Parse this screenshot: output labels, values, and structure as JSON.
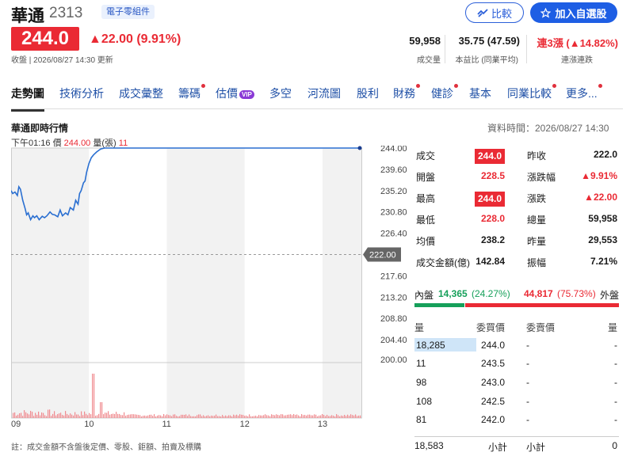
{
  "header": {
    "name": "華通",
    "code": "2313",
    "industry": "電子零組件",
    "compare_label": "比較",
    "watchlist_label": "加入自選股"
  },
  "quote": {
    "price": "244.0",
    "change": "▲22.00 (9.91%)",
    "status_line": "收盤 | 2026/08/27 14:30 更新"
  },
  "summary": [
    {
      "value": "59,958",
      "label": "成交量",
      "color": "#1a1a1a"
    },
    {
      "value": "35.75 (47.59)",
      "label": "本益比 (同業平均)",
      "color": "#1a1a1a"
    },
    {
      "value": "連3漲 (▲14.82%)",
      "label": "連漲連跌",
      "color": "#ea2a34"
    }
  ],
  "tabs": [
    {
      "label": "走勢圖",
      "active": true,
      "dot": false,
      "vip": false
    },
    {
      "label": "技術分析",
      "active": false,
      "dot": false,
      "vip": false
    },
    {
      "label": "成交彙整",
      "active": false,
      "dot": false,
      "vip": false
    },
    {
      "label": "籌碼",
      "active": false,
      "dot": true,
      "vip": false
    },
    {
      "label": "估價",
      "active": false,
      "dot": false,
      "vip": true
    },
    {
      "label": "多空",
      "active": false,
      "dot": false,
      "vip": false
    },
    {
      "label": "河流圖",
      "active": false,
      "dot": false,
      "vip": false
    },
    {
      "label": "股利",
      "active": false,
      "dot": false,
      "vip": false
    },
    {
      "label": "財務",
      "active": false,
      "dot": true,
      "vip": false
    },
    {
      "label": "健診",
      "active": false,
      "dot": true,
      "vip": false
    },
    {
      "label": "基本",
      "active": false,
      "dot": false,
      "vip": false
    },
    {
      "label": "同業比較",
      "active": false,
      "dot": true,
      "vip": false
    },
    {
      "label": "更多...",
      "active": false,
      "dot": true,
      "vip": false
    }
  ],
  "vip_label": "VIP",
  "section": {
    "title": "華通即時行情",
    "data_time": "資料時間：2026/08/27 14:30",
    "hover_time": "下午01:16",
    "hover_price_label": "價",
    "hover_price": "244.00",
    "hover_volume_label": "量(張)",
    "hover_volume": "11",
    "footnote": "註：成交金額不含盤後定價、零股、鉅額、拍賣及標購"
  },
  "chart_data": {
    "type": "line",
    "title": "",
    "xlabel": "",
    "ylabel": "",
    "x_ticks": [
      "09",
      "10",
      "11",
      "12",
      "13"
    ],
    "y_ticks": [
      "244.00",
      "239.60",
      "235.20",
      "230.80",
      "226.40",
      "222.00",
      "217.60",
      "213.20",
      "208.80",
      "204.40",
      "200.00"
    ],
    "ylim": [
      200.0,
      244.0
    ],
    "reference_price": 222.0,
    "reference_label": "222.00",
    "session_hours": [
      9.0,
      13.5
    ],
    "price_series": {
      "x": [
        9.0,
        9.02,
        9.05,
        9.08,
        9.1,
        9.12,
        9.15,
        9.18,
        9.2,
        9.22,
        9.25,
        9.28,
        9.3,
        9.33,
        9.36,
        9.4,
        9.43,
        9.46,
        9.5,
        9.53,
        9.56,
        9.6,
        9.63,
        9.66,
        9.7,
        9.73,
        9.76,
        9.8,
        9.83,
        9.86,
        9.88,
        9.9,
        9.93,
        9.95,
        9.97,
        10.0,
        10.03,
        10.06,
        10.1,
        10.15,
        10.2,
        10.25,
        10.5,
        11.0,
        12.0,
        13.0,
        13.27,
        13.5
      ],
      "y": [
        235.2,
        234.6,
        234.9,
        234.2,
        236.0,
        235.5,
        233.2,
        231.5,
        230.2,
        230.6,
        229.2,
        230.0,
        229.6,
        230.0,
        229.2,
        229.9,
        229.6,
        230.0,
        230.8,
        230.3,
        230.2,
        229.8,
        231.2,
        230.0,
        230.6,
        230.2,
        231.7,
        231.2,
        233.2,
        232.4,
        234.6,
        235.2,
        236.8,
        237.2,
        239.0,
        240.8,
        242.0,
        242.6,
        243.2,
        243.8,
        244.0,
        244.0,
        244.0,
        244.0,
        244.0,
        244.0,
        244.0,
        244.0
      ]
    },
    "volume_series": {
      "note_peak_times": [
        10.05,
        10.15
      ]
    },
    "colors": {
      "line": "#2a6fd1",
      "reference": "#999999",
      "volume": "#f08a8f",
      "shade": "#f2f2f2"
    }
  },
  "quote_table": [
    {
      "l_label": "成交",
      "l_value": "244.0",
      "l_badge": true,
      "l_color": "",
      "r_label": "昨收",
      "r_value": "222.0",
      "r_badge": false,
      "r_color": ""
    },
    {
      "l_label": "開盤",
      "l_value": "228.5",
      "l_badge": false,
      "l_color": "red",
      "r_label": "漲跌幅",
      "r_value": "▲9.91%",
      "r_badge": false,
      "r_color": "red"
    },
    {
      "l_label": "最高",
      "l_value": "244.0",
      "l_badge": true,
      "l_color": "",
      "r_label": "漲跌",
      "r_value": "▲22.00",
      "r_badge": false,
      "r_color": "red"
    },
    {
      "l_label": "最低",
      "l_value": "228.0",
      "l_badge": false,
      "l_color": "red",
      "r_label": "總量",
      "r_value": "59,958",
      "r_badge": false,
      "r_color": ""
    },
    {
      "l_label": "均價",
      "l_value": "238.2",
      "l_badge": false,
      "l_color": "",
      "r_label": "昨量",
      "r_value": "29,553",
      "r_badge": false,
      "r_color": ""
    },
    {
      "l_label": "成交金額(億)",
      "l_value": "142.84",
      "l_badge": false,
      "l_color": "",
      "r_label": "振幅",
      "r_value": "7.21%",
      "r_badge": false,
      "r_color": ""
    }
  ],
  "orderbook": {
    "inner_label": "內盤",
    "inner_value": "14,365",
    "inner_pct": "(24.27%)",
    "inner_ratio": 24.27,
    "outer_value": "44,817",
    "outer_pct": "(75.73%)",
    "outer_label": "外盤",
    "headers": [
      "量",
      "委買價",
      "委賣價",
      "量"
    ],
    "rows": [
      {
        "bid_vol": "18,285",
        "bid_price": "244.0",
        "ask_price": "-",
        "ask_vol": "-",
        "highlight": true
      },
      {
        "bid_vol": "11",
        "bid_price": "243.5",
        "ask_price": "-",
        "ask_vol": "-",
        "highlight": false
      },
      {
        "bid_vol": "98",
        "bid_price": "243.0",
        "ask_price": "-",
        "ask_vol": "-",
        "highlight": false
      },
      {
        "bid_vol": "108",
        "bid_price": "242.5",
        "ask_price": "-",
        "ask_vol": "-",
        "highlight": false
      },
      {
        "bid_vol": "81",
        "bid_price": "242.0",
        "ask_price": "-",
        "ask_vol": "-",
        "highlight": false
      }
    ],
    "total_bid": "18,583",
    "subtotal_label": "小計",
    "total_ask": "0"
  }
}
